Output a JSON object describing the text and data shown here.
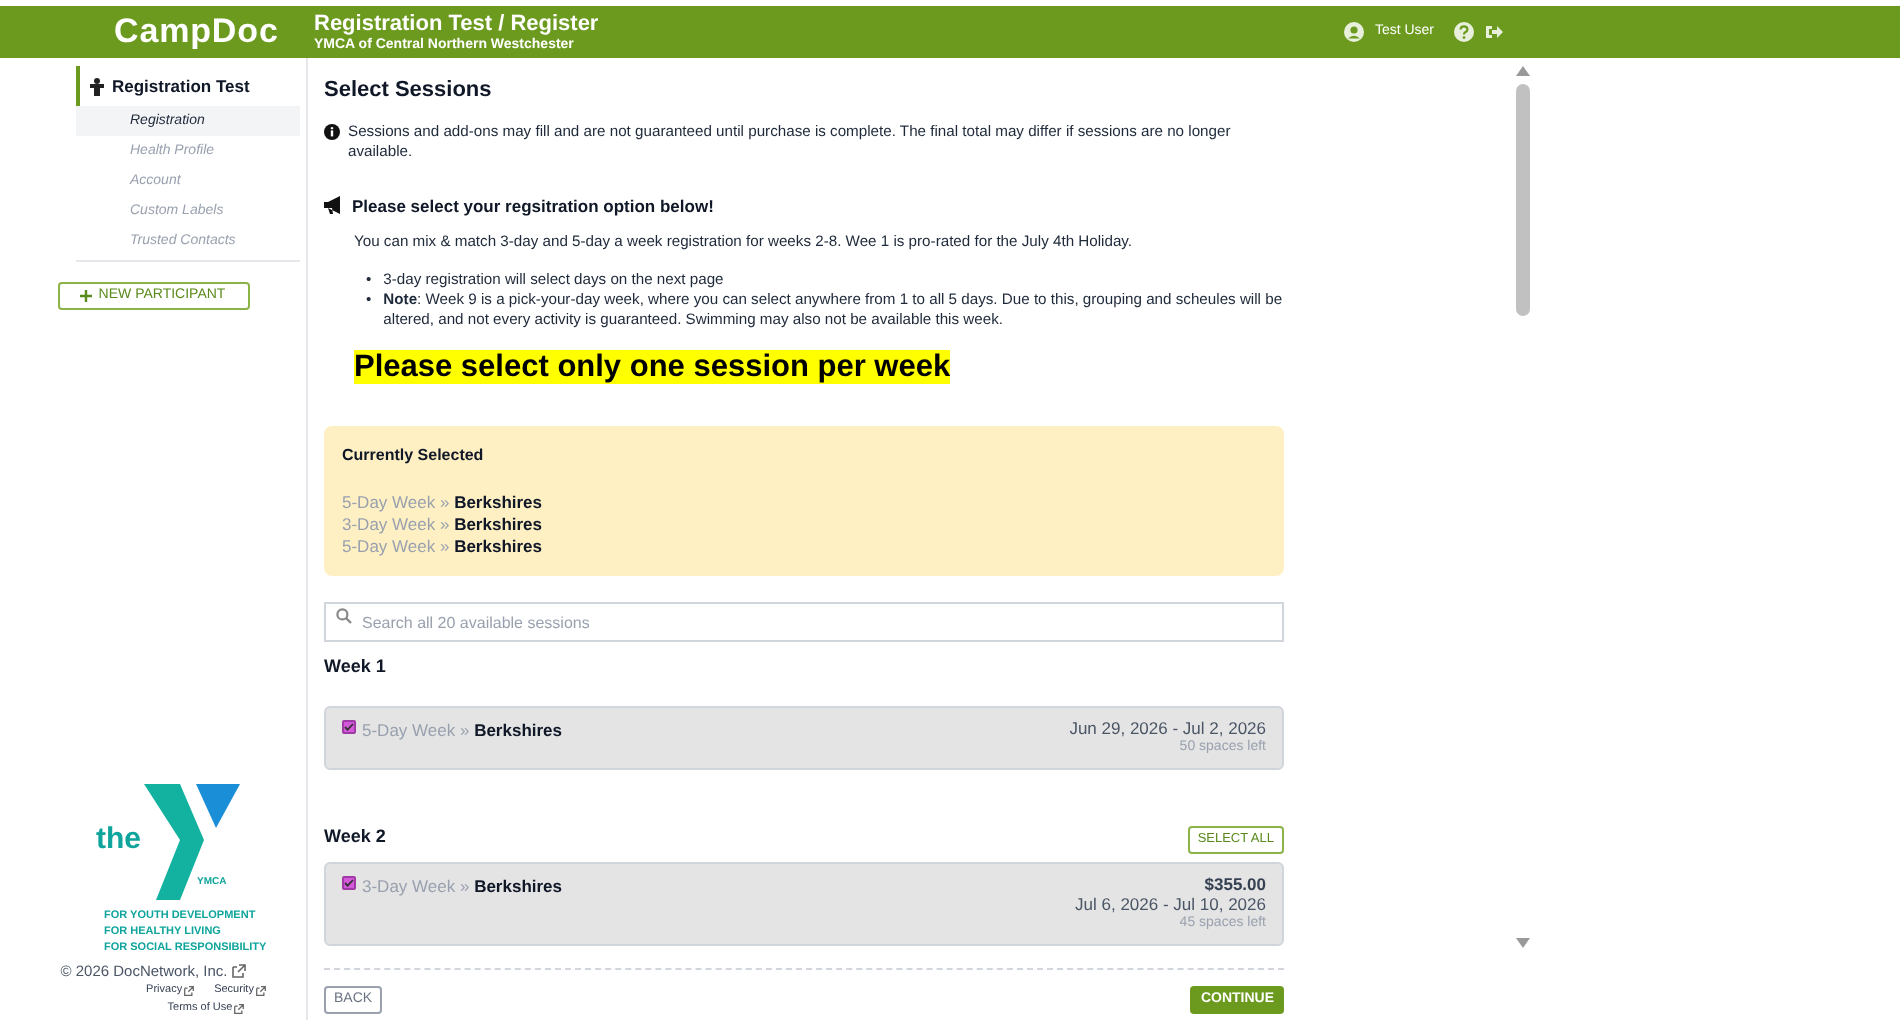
{
  "header": {
    "logo": "CampDoc",
    "title": "Registration Test / Register",
    "subtitle": "YMCA of Central Northern Westchester",
    "user": "Test User"
  },
  "sidebar": {
    "participant": "Registration Test",
    "items": [
      {
        "label": "Registration",
        "selected": true
      },
      {
        "label": "Health Profile",
        "selected": false
      },
      {
        "label": "Account",
        "selected": false
      },
      {
        "label": "Custom Labels",
        "selected": false
      },
      {
        "label": "Trusted Contacts",
        "selected": false
      }
    ],
    "new_participant": "NEW PARTICIPANT",
    "logo_word": "the",
    "logo_mark": "YMCA",
    "taglines": [
      "FOR YOUTH DEVELOPMENT",
      "FOR HEALTHY LIVING",
      "FOR SOCIAL RESPONSIBILITY"
    ],
    "copyright": "© 2026 DocNetwork, Inc.",
    "links": [
      "Privacy",
      "Security",
      "Terms of Use"
    ]
  },
  "main": {
    "title": "Select Sessions",
    "notice": "Sessions and add-ons may fill and are not guaranteed until purchase is complete. The final total may differ if sessions are no longer available.",
    "announcement_title": "Please select your regsitration option below!",
    "announcement_text": "You can mix & match 3-day and 5-day a week registration for weeks 2-8. Wee 1 is pro-rated for the July 4th Holiday.",
    "bullet_marker": "•",
    "bullets": [
      "3-day registration will select days on the next page",
      "**Note**: Week 9 is a pick-your-day week, where you can select anywhere from 1 to all 5 days. Due to this, grouping and scheules will be altered, and not every activity is guaranteed. Swimming may also not be available this week."
    ],
    "highlight": "Please select only one session per week",
    "currently_selected": {
      "title": "Currently Selected",
      "items": [
        {
          "type": "5-Day Week",
          "sep": "»",
          "name": "Berkshires"
        },
        {
          "type": "3-Day Week",
          "sep": "»",
          "name": "Berkshires"
        },
        {
          "type": "5-Day Week",
          "sep": "»",
          "name": "Berkshires"
        }
      ]
    },
    "search": {
      "placeholder": "Search all 20 available sessions"
    },
    "weeks": [
      {
        "title": "Week 1",
        "sessions": [
          {
            "type": "5-Day Week",
            "sep": "»",
            "name": "Berkshires",
            "checked": true,
            "dates": "Jun 29, 2026 - Jul 2, 2026",
            "spaces": "50 spaces left"
          }
        ]
      },
      {
        "title": "Week 2",
        "select_all": "SELECT ALL",
        "sessions": [
          {
            "type": "3-Day Week",
            "sep": "»",
            "name": "Berkshires",
            "checked": true,
            "price": "$355.00",
            "dates": "Jul 6, 2026 - Jul 10, 2026",
            "spaces": "45 spaces left"
          }
        ]
      }
    ],
    "back": "BACK",
    "continue": "CONTINUE"
  }
}
